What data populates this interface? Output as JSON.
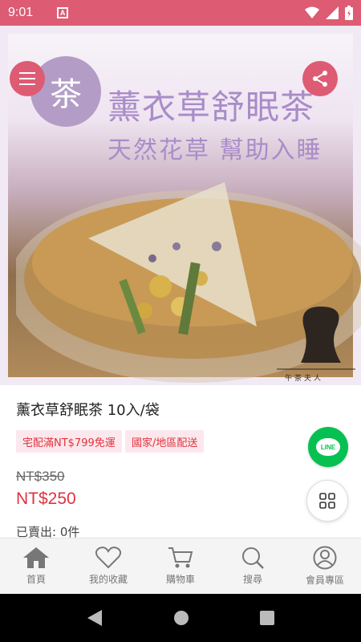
{
  "status_bar": {
    "time": "9:01",
    "notification_icon": "A"
  },
  "hero": {
    "badge_text": "茶",
    "title": "薰衣草舒眠茶",
    "subtitle": "天然花草 幫助入睡",
    "brand_mark": "午茶夫人"
  },
  "product": {
    "name": "薰衣草舒眠茶 10入/袋",
    "tags": [
      "宅配滿NT$799免運",
      "國家/地區配送"
    ],
    "original_price": "NT$350",
    "sale_price": "NT$250",
    "sold": "已賣出: 0件"
  },
  "floating": {
    "line_label": "LINE"
  },
  "bottom_nav": [
    {
      "label": "首頁",
      "icon": "home-icon"
    },
    {
      "label": "我的收藏",
      "icon": "heart-icon"
    },
    {
      "label": "購物車",
      "icon": "cart-icon"
    },
    {
      "label": "搜尋",
      "icon": "search-icon"
    },
    {
      "label": "會員專區",
      "icon": "user-icon"
    }
  ],
  "colors": {
    "accent": "#dd5b73",
    "price": "#e0323f",
    "line": "#06c152",
    "lavender": "#a98cc8"
  }
}
